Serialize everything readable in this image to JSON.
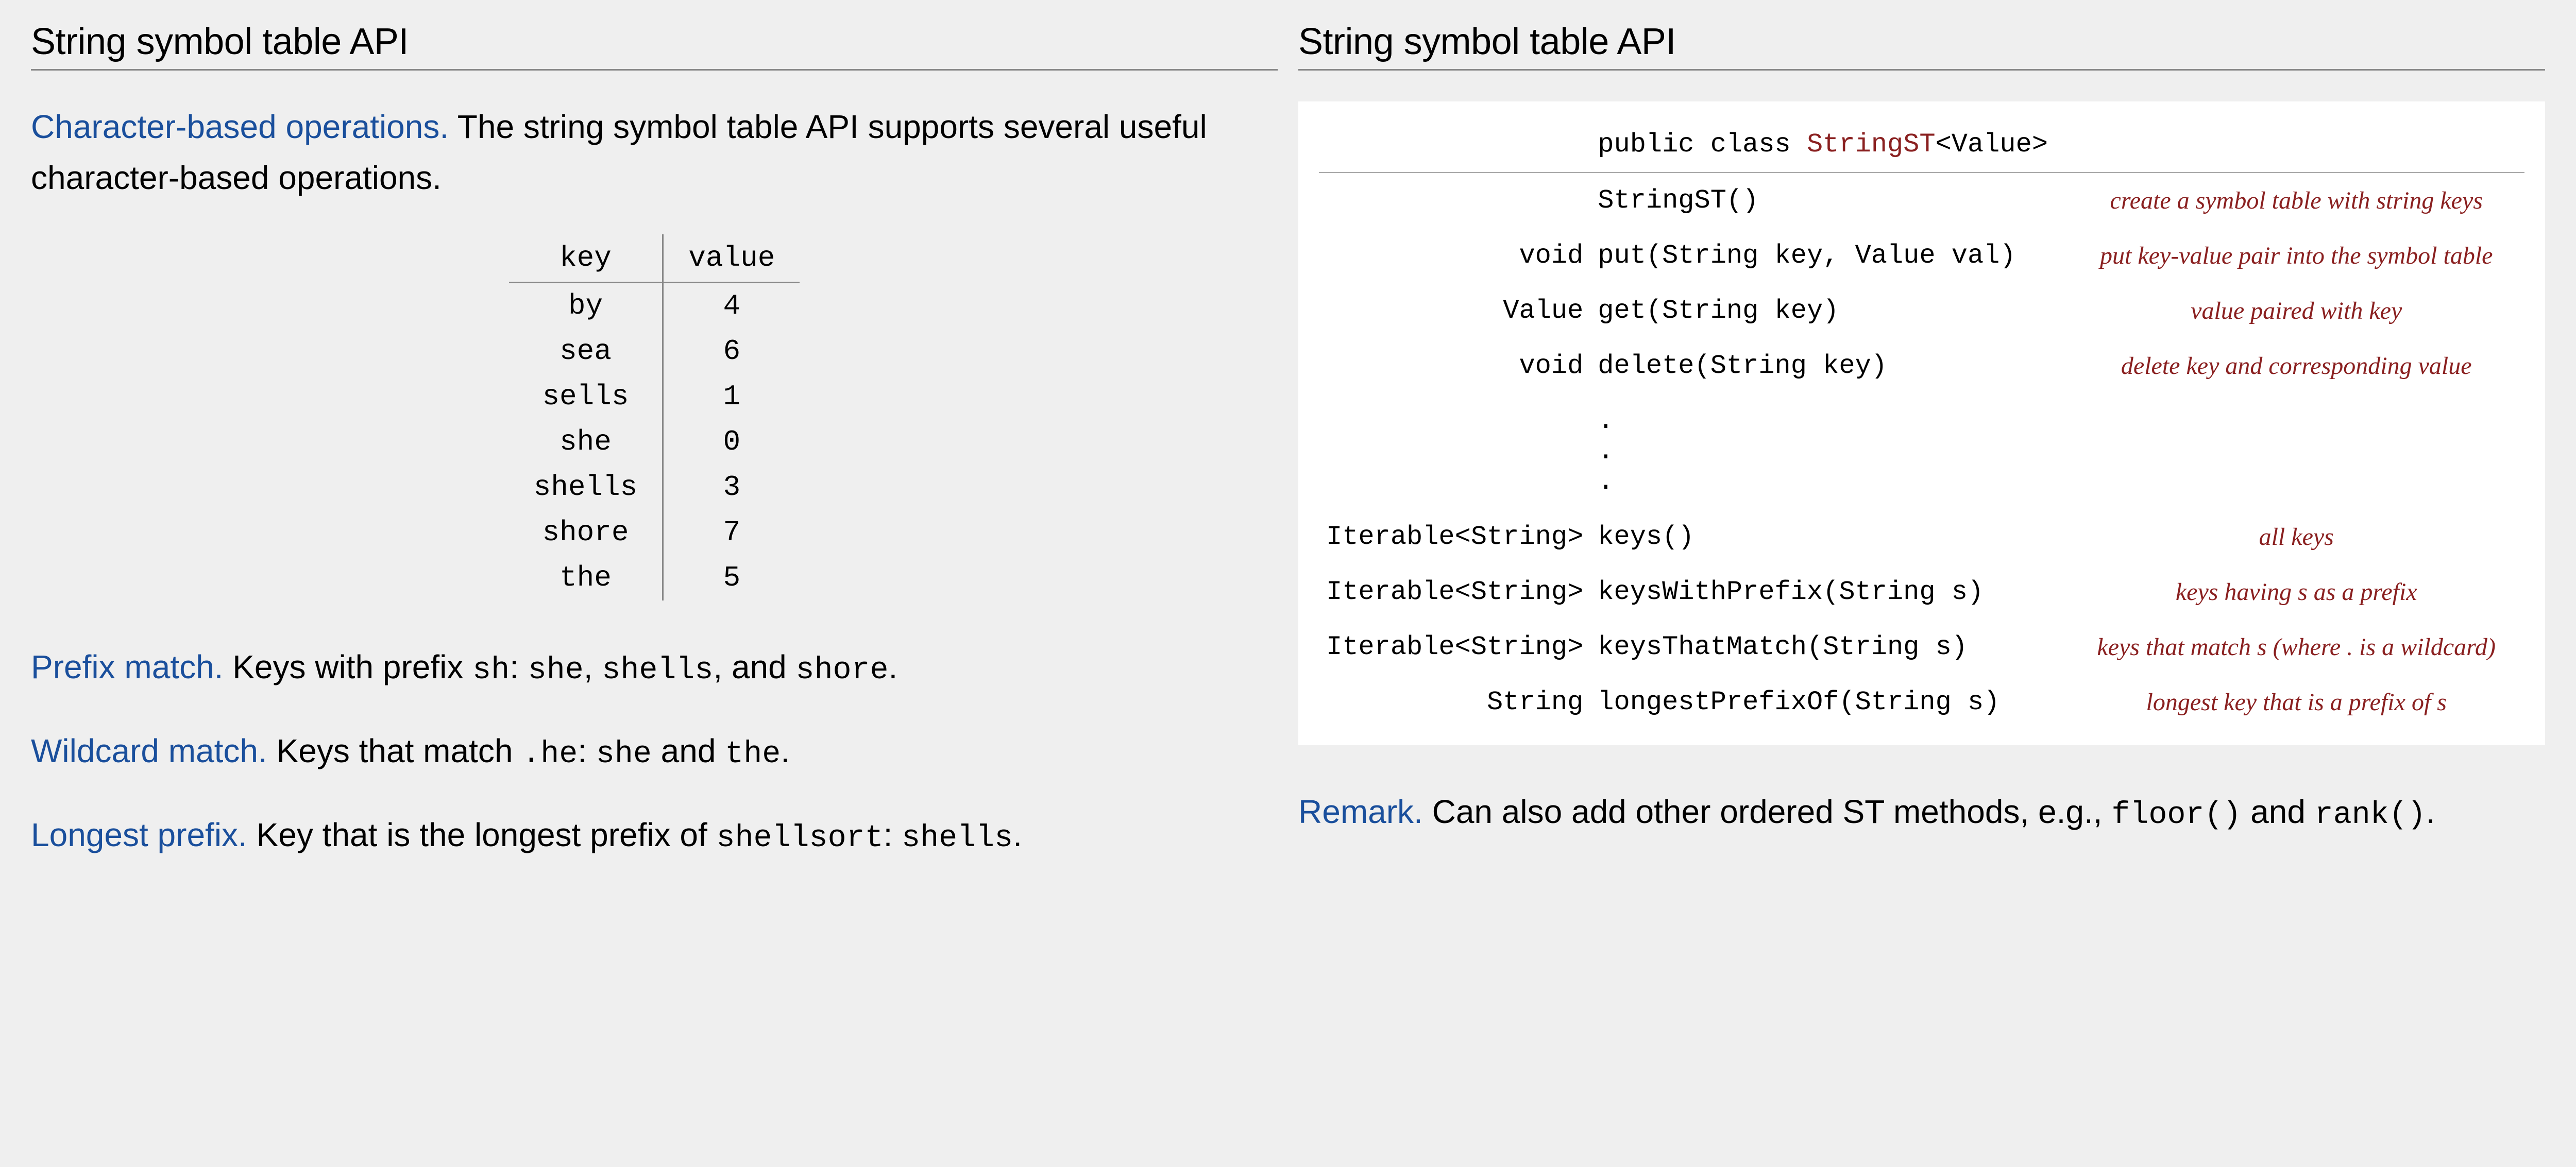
{
  "left": {
    "title": "String symbol table API",
    "intro_lead": "Character-based operations.",
    "intro_body": "  The string symbol table API supports several useful character-based operations.",
    "kv_headers": {
      "key": "key",
      "value": "value"
    },
    "kv_rows": [
      {
        "key": "by",
        "value": "4"
      },
      {
        "key": "sea",
        "value": "6"
      },
      {
        "key": "sells",
        "value": "1"
      },
      {
        "key": "she",
        "value": "0"
      },
      {
        "key": "shells",
        "value": "3"
      },
      {
        "key": "shore",
        "value": "7"
      },
      {
        "key": "the",
        "value": "5"
      }
    ],
    "prefix": {
      "lead": "Prefix match.",
      "t1": "  Keys with prefix ",
      "c1": "sh",
      "t2": ":  ",
      "c2": "she",
      "t3": ", ",
      "c3": "shells",
      "t4": ",  and ",
      "c4": "shore",
      "t5": "."
    },
    "wildcard": {
      "lead": "Wildcard match.",
      "t1": "  Keys that match ",
      "c1": ".he",
      "t2": ":  ",
      "c2": "she",
      "t3": " and ",
      "c3": "the",
      "t4": "."
    },
    "longest": {
      "lead": "Longest prefix.",
      "t1": "  Key that is the longest prefix of ",
      "c1": "shellsort",
      "t2": ":  ",
      "c2": "shells",
      "t3": "."
    }
  },
  "right": {
    "title": "String symbol table API",
    "api_head": {
      "pre": "public class ",
      "cls": "StringST",
      "post": "<Value>"
    },
    "rows": [
      {
        "ret": "",
        "sig": "StringST()",
        "desc": "create a symbol table with string keys"
      },
      {
        "ret": "void",
        "sig": "put(String key, Value val)",
        "desc": "put key-value pair into the symbol table"
      },
      {
        "ret": "Value",
        "sig": "get(String key)",
        "desc": "value paired with key"
      },
      {
        "ret": "void",
        "sig": "delete(String key)",
        "desc": "delete key and corresponding value"
      },
      {
        "ret": "Iterable<String>",
        "sig": "keys()",
        "desc": "all keys"
      },
      {
        "ret": "Iterable<String>",
        "sig": "keysWithPrefix(String s)",
        "desc": "keys having s as a prefix"
      },
      {
        "ret": "Iterable<String>",
        "sig": "keysThatMatch(String s)",
        "desc": "keys that match s (where . is a wildcard)"
      },
      {
        "ret": "String",
        "sig": "longestPrefixOf(String s)",
        "desc": "longest key that is a prefix of s"
      }
    ],
    "vdots_after_index": 3,
    "remark": {
      "lead": "Remark.",
      "t1": "  Can also add other ordered ST methods, e.g., ",
      "c1": "floor()",
      "t2": " and ",
      "c2": "rank()",
      "t3": "."
    }
  }
}
